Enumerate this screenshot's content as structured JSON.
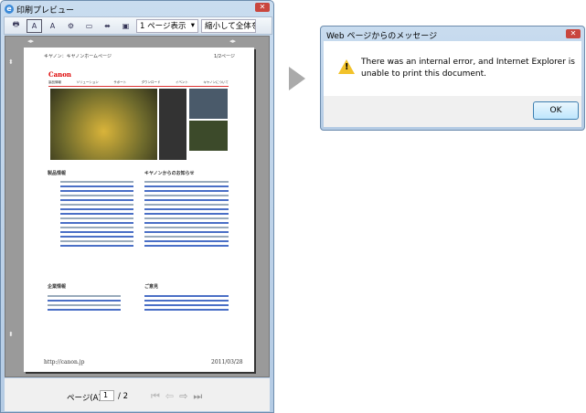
{
  "preview_window": {
    "title": "印刷プレビュー",
    "toolbar": {
      "page_view": "1 ページ表示",
      "scale": "縮小して全体を印"
    },
    "page": {
      "header_title": "キヤノン：キヤノンホームページ",
      "page_label": "1/2ページ",
      "logo": "Canon",
      "nav": [
        "製品情報",
        "ソリューション",
        "サポート",
        "ダウンロード",
        "イベント",
        "キヤノンについて"
      ],
      "sections": [
        "製品情報",
        "キヤノンからのお知らせ",
        "企業情報",
        "ご意見"
      ],
      "footer_url": "http://canon.jp",
      "footer_date": "2011/03/28"
    },
    "pager": {
      "label": "ページ(A)",
      "current": "1",
      "total": "/ 2"
    }
  },
  "dialog": {
    "title": "Web ページからのメッセージ",
    "message": "There was an internal error, and Internet Explorer is unable to print this document.",
    "ok_label": "OK",
    "icon": "warning-icon"
  }
}
